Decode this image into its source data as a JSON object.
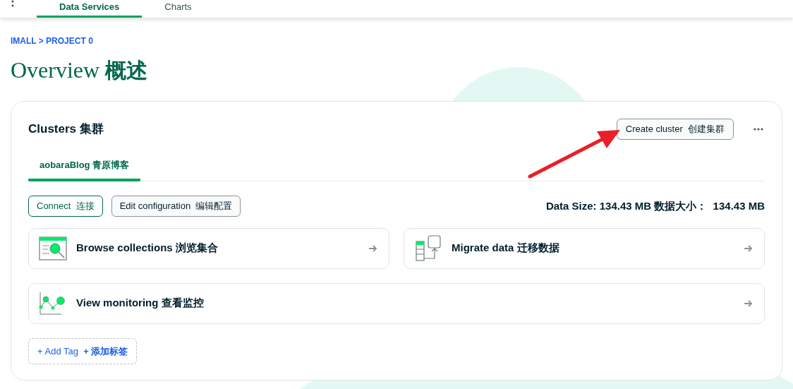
{
  "nav": {
    "tabs": [
      {
        "label": "Data Services",
        "selected": true
      },
      {
        "label": "Charts",
        "selected": false
      }
    ]
  },
  "breadcrumb": "IMALL > PROJECT 0",
  "page_title": {
    "latin": "Overview",
    "cjk": "概述"
  },
  "clusters": {
    "title": "Clusters 集群",
    "create_button": "Create cluster  创建集群",
    "tabs": [
      {
        "label": "aobaraBlog 青原博客",
        "selected": true
      }
    ],
    "buttons": [
      {
        "label": "Connect  连接",
        "kind": "primary"
      },
      {
        "label": "Edit configuration  编辑配置",
        "kind": "secondary"
      }
    ],
    "data_size": "Data Size: 134.43 MB 数据大小：  134.43 MB",
    "action_rows": [
      [
        {
          "label": "Browse collections 浏览集合",
          "kind": "browse"
        },
        {
          "label": "Migrate data 迁移数据",
          "kind": "migrate"
        }
      ],
      [
        {
          "label": "View monitoring 查看监控",
          "kind": "monitor"
        }
      ]
    ],
    "add_tag": "+ Add Tag  **+ 添加标签**"
  }
}
